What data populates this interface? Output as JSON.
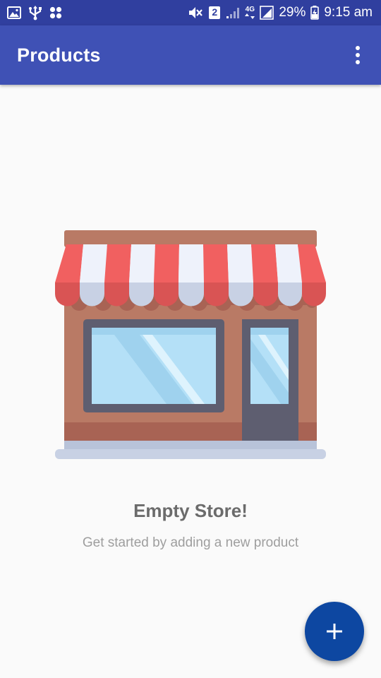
{
  "status_bar": {
    "left_icons": [
      "image-icon",
      "usb-icon",
      "app-grid-icon"
    ],
    "sim_badge": "2",
    "network_type": "4G",
    "battery_percent": "29%",
    "time": "9:15 am"
  },
  "app_bar": {
    "title": "Products",
    "menu_icon": "more-vert-icon"
  },
  "empty_state": {
    "illustration": "storefront-icon",
    "title": "Empty Store!",
    "subtitle": "Get started by adding a new product"
  },
  "fab": {
    "icon": "plus-icon",
    "color": "#0d47a1"
  },
  "colors": {
    "status_bar": "#303f9f",
    "app_bar": "#3f51b5",
    "background": "#fafafa"
  }
}
